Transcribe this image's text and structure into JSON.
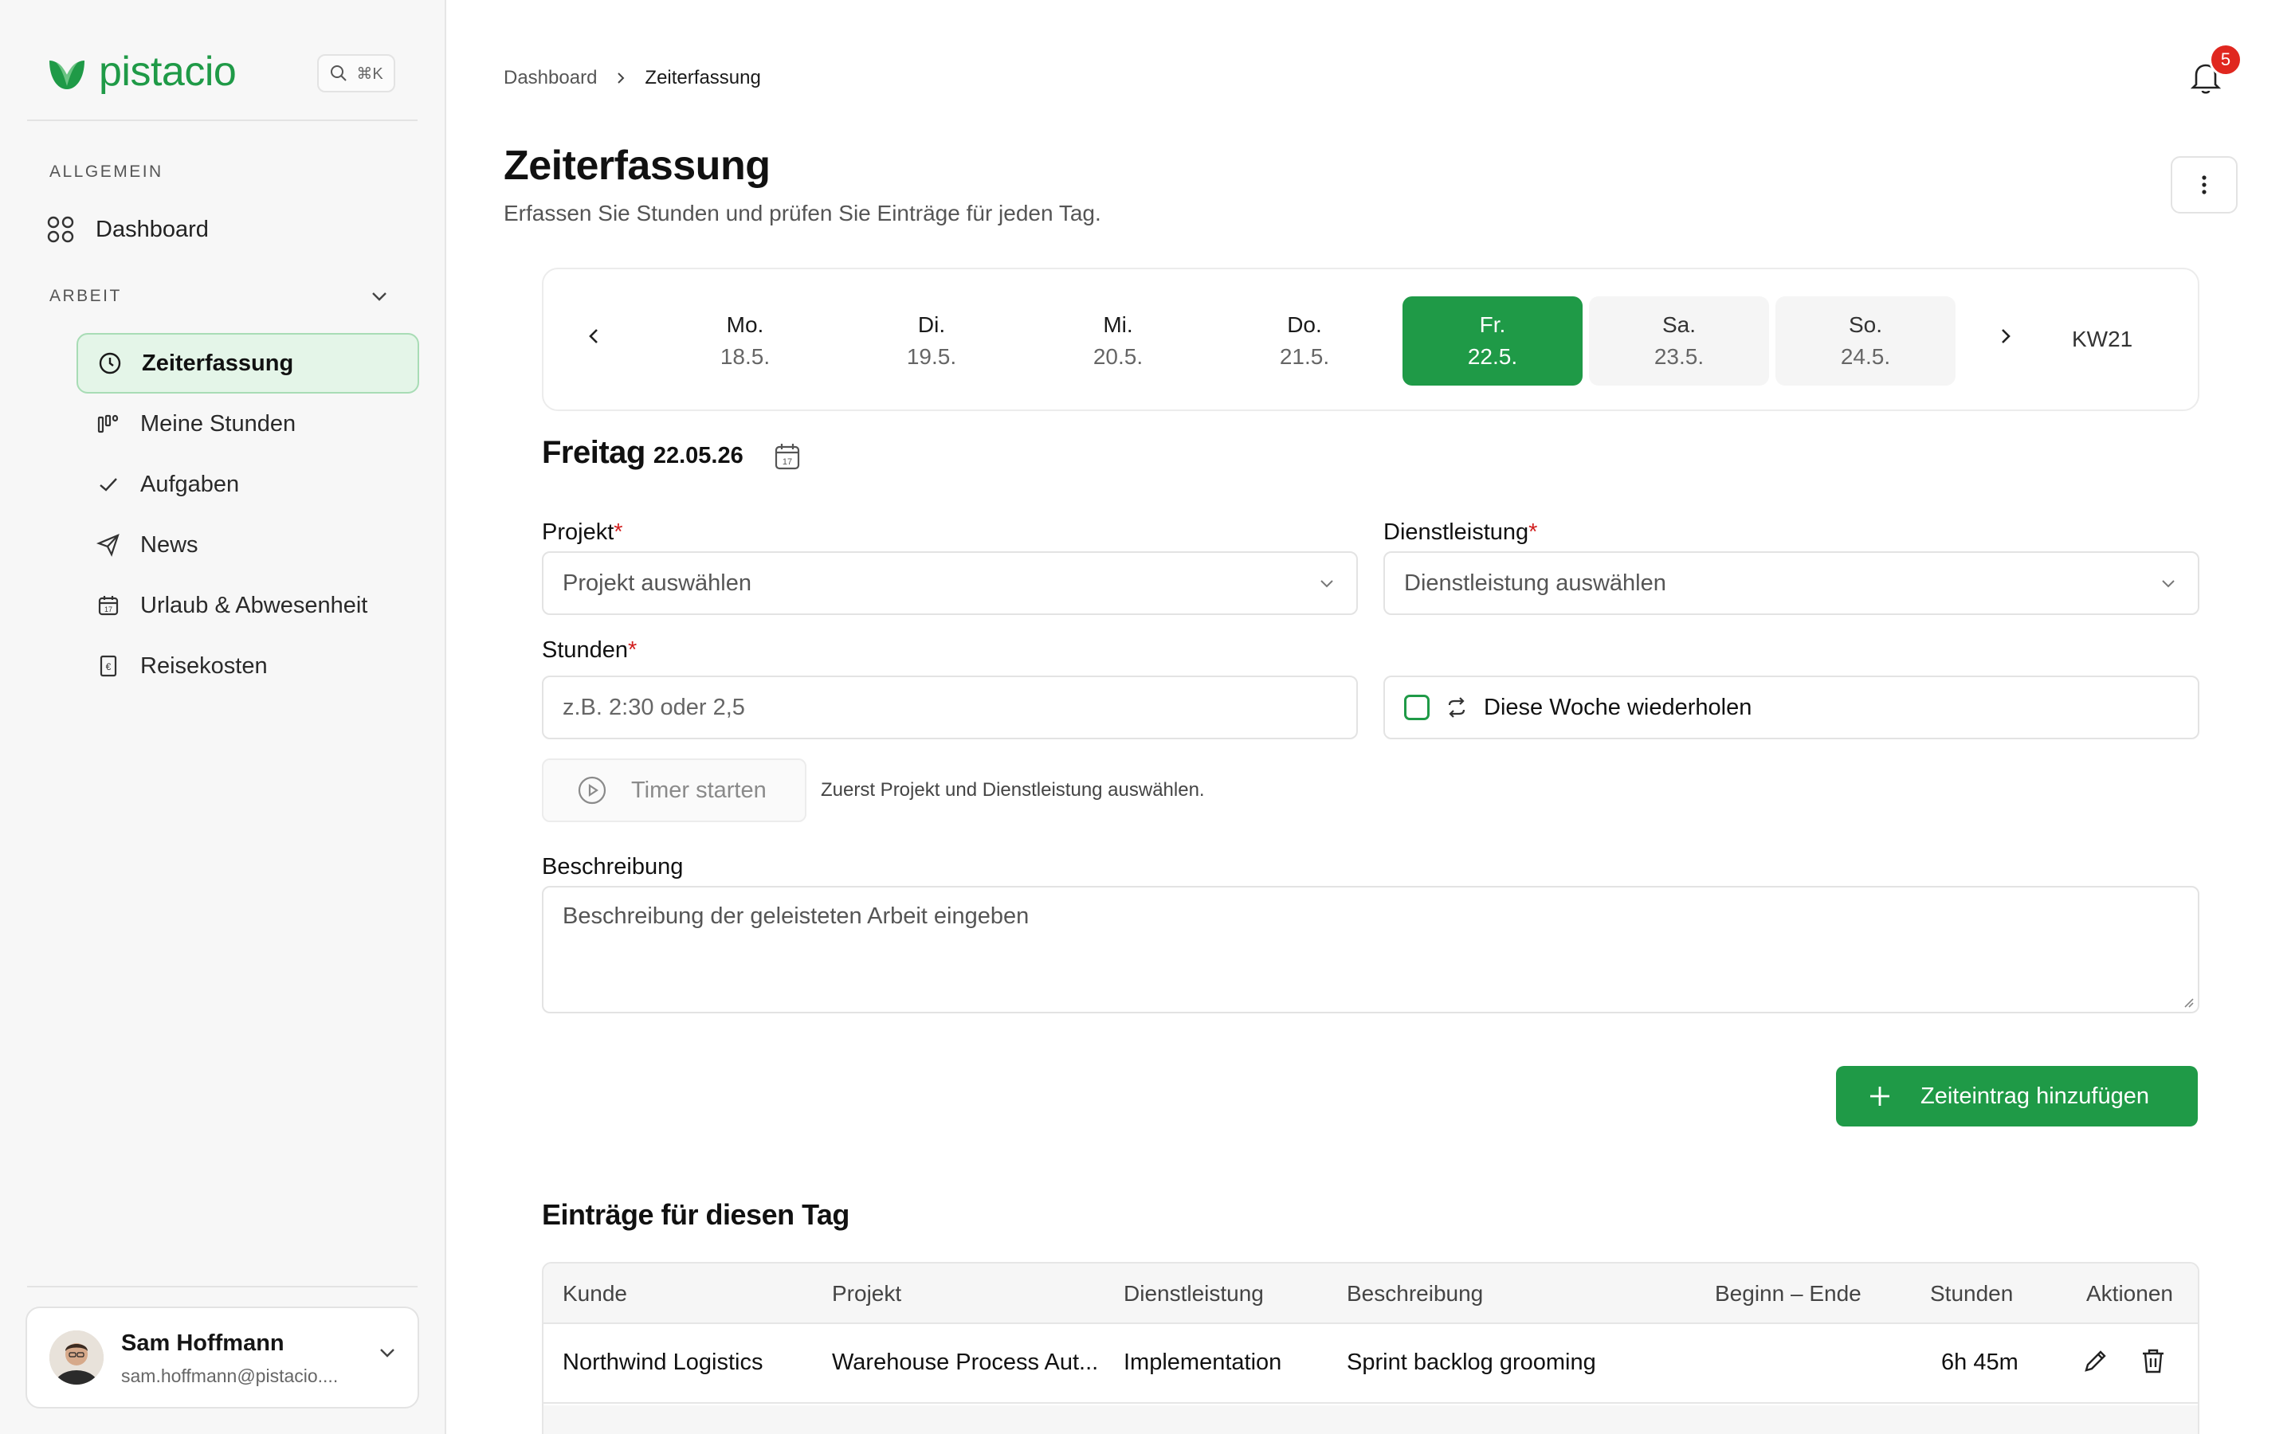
{
  "app": {
    "brand": "pistacio",
    "search_shortcut": "⌘K"
  },
  "sidebar": {
    "section_general": "ALLGEMEIN",
    "dashboard_label": "Dashboard",
    "section_work": "ARBEIT",
    "items": [
      {
        "label": "Zeiterfassung",
        "icon": "clock-icon",
        "active": true
      },
      {
        "label": "Meine Stunden",
        "icon": "bar-chart-icon",
        "active": false
      },
      {
        "label": "Aufgaben",
        "icon": "check-icon",
        "active": false
      },
      {
        "label": "News",
        "icon": "send-icon",
        "active": false
      },
      {
        "label": "Urlaub & Abwesenheit",
        "icon": "calendar-icon",
        "active": false
      },
      {
        "label": "Reisekosten",
        "icon": "receipt-icon",
        "active": false
      }
    ],
    "user": {
      "name": "Sam Hoffmann",
      "email": "sam.hoffmann@pistacio...."
    }
  },
  "header": {
    "breadcrumb": [
      "Dashboard",
      "Zeiterfassung"
    ],
    "notifications_count": "5",
    "title": "Zeiterfassung",
    "subtitle": "Erfassen Sie Stunden und prüfen Sie Einträge für jeden Tag."
  },
  "week": {
    "days": [
      {
        "name": "Mo.",
        "date": "18.5."
      },
      {
        "name": "Di.",
        "date": "19.5."
      },
      {
        "name": "Mi.",
        "date": "20.5."
      },
      {
        "name": "Do.",
        "date": "21.5."
      },
      {
        "name": "Fr.",
        "date": "22.5."
      },
      {
        "name": "Sa.",
        "date": "23.5."
      },
      {
        "name": "So.",
        "date": "24.5."
      }
    ],
    "selected_index": 4,
    "week_label": "KW21"
  },
  "form": {
    "day_name": "Freitag",
    "day_date": "22.05.26",
    "project_label": "Projekt",
    "project_placeholder": "Projekt auswählen",
    "service_label": "Dienstleistung",
    "service_placeholder": "Dienstleistung auswählen",
    "hours_label": "Stunden",
    "hours_placeholder": "z.B. 2:30 oder 2,5",
    "repeat_label": "Diese Woche wiederholen",
    "timer_label": "Timer starten",
    "timer_hint": "Zuerst Projekt und Dienstleistung auswählen.",
    "description_label": "Beschreibung",
    "description_placeholder": "Beschreibung der geleisteten Arbeit eingeben",
    "required_mark": "*",
    "add_button": "Zeiteintrag hinzufügen"
  },
  "entries": {
    "title": "Einträge für diesen Tag",
    "columns": [
      "Kunde",
      "Projekt",
      "Dienstleistung",
      "Beschreibung",
      "Beginn – Ende",
      "Stunden",
      "Aktionen"
    ],
    "rows": [
      {
        "kunde": "Northwind Logistics",
        "projekt": "Warehouse Process Aut...",
        "dienstleistung": "Implementation",
        "beschreibung": "Sprint backlog grooming",
        "beginn_ende": "",
        "stunden": "6h 45m"
      }
    ]
  },
  "colors": {
    "accent": "#1f9a47",
    "badge": "#e0271f",
    "active_bg": "#e4f5e8"
  }
}
